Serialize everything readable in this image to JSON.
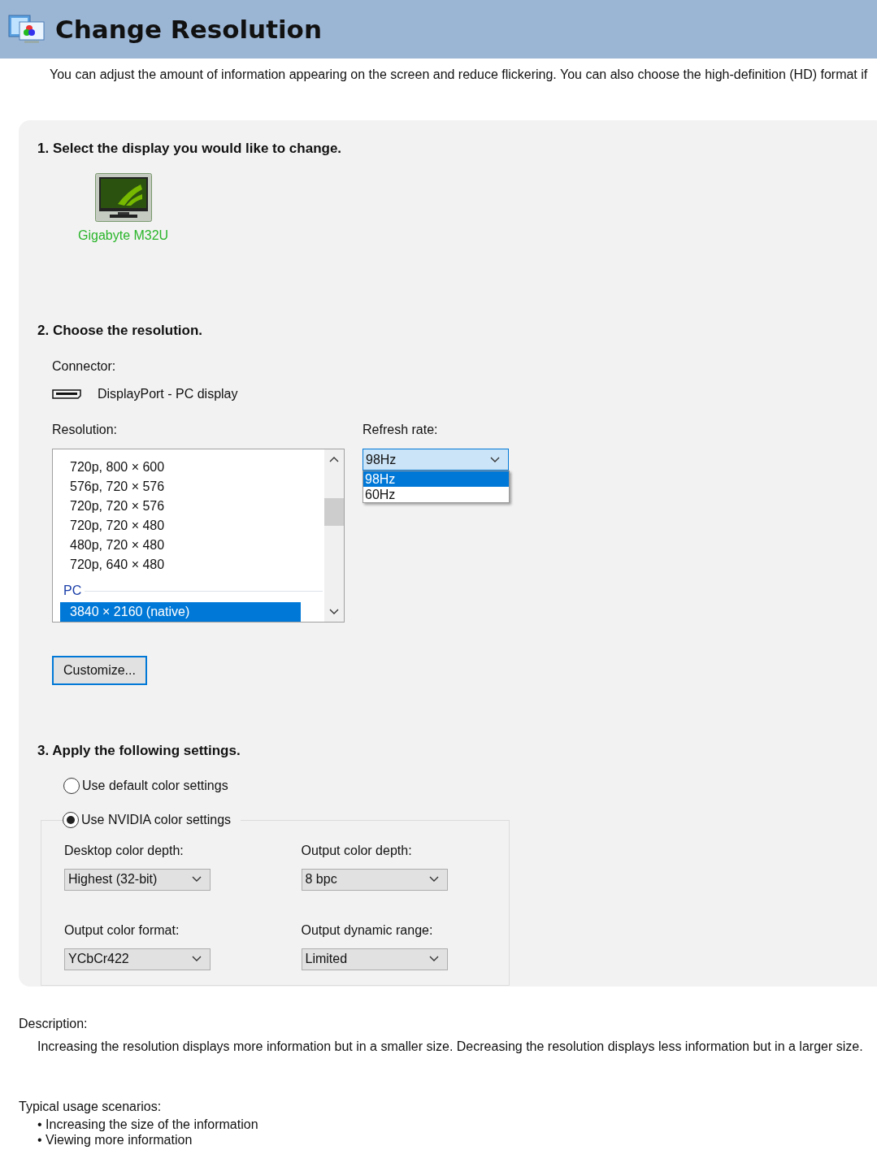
{
  "header": {
    "title": "Change Resolution"
  },
  "intro": "You can adjust the amount of information appearing on the screen and reduce flickering. You can also choose the high-definition (HD) format if",
  "step1": {
    "heading": "1. Select the display you would like to change.",
    "displays": [
      {
        "name": "Gigabyte M32U",
        "selected": true
      }
    ]
  },
  "step2": {
    "heading": "2. Choose the resolution.",
    "connector_label": "Connector:",
    "connector": "DisplayPort - PC display",
    "resolution_label": "Resolution:",
    "resolutions": [
      {
        "kind": "item",
        "label": "720p, 800 × 600",
        "selected": false
      },
      {
        "kind": "item",
        "label": "576p, 720 × 576",
        "selected": false
      },
      {
        "kind": "item",
        "label": "720p, 720 × 576",
        "selected": false
      },
      {
        "kind": "item",
        "label": "720p, 720 × 480",
        "selected": false
      },
      {
        "kind": "item",
        "label": "480p, 720 × 480",
        "selected": false
      },
      {
        "kind": "item",
        "label": "720p, 640 × 480",
        "selected": false
      },
      {
        "kind": "group",
        "label": "PC"
      },
      {
        "kind": "item",
        "label": "3840 × 2160 (native)",
        "selected": true
      }
    ],
    "refresh_label": "Refresh rate:",
    "refresh_value": "98Hz",
    "refresh_options": [
      {
        "label": "98Hz",
        "selected": true
      },
      {
        "label": "60Hz",
        "selected": false
      }
    ],
    "customize_button": "Customize..."
  },
  "step3": {
    "heading": "3. Apply the following settings.",
    "options": [
      {
        "label": "Use default color settings",
        "selected": false
      },
      {
        "label": "Use NVIDIA color settings",
        "selected": true
      }
    ],
    "dropdowns": [
      {
        "label": "Desktop color depth:",
        "value": "Highest (32-bit)"
      },
      {
        "label": "Output color depth:",
        "value": "8 bpc"
      },
      {
        "label": "Output color format:",
        "value": "YCbCr422"
      },
      {
        "label": "Output dynamic range:",
        "value": "Limited"
      }
    ]
  },
  "description": {
    "label": "Description:",
    "text": "Increasing the resolution displays more information but in a smaller size. Decreasing the resolution displays less information but in a larger size."
  },
  "usage": {
    "label": "Typical usage scenarios:",
    "items": [
      "• Increasing the size of the information",
      "• Viewing more information"
    ]
  }
}
